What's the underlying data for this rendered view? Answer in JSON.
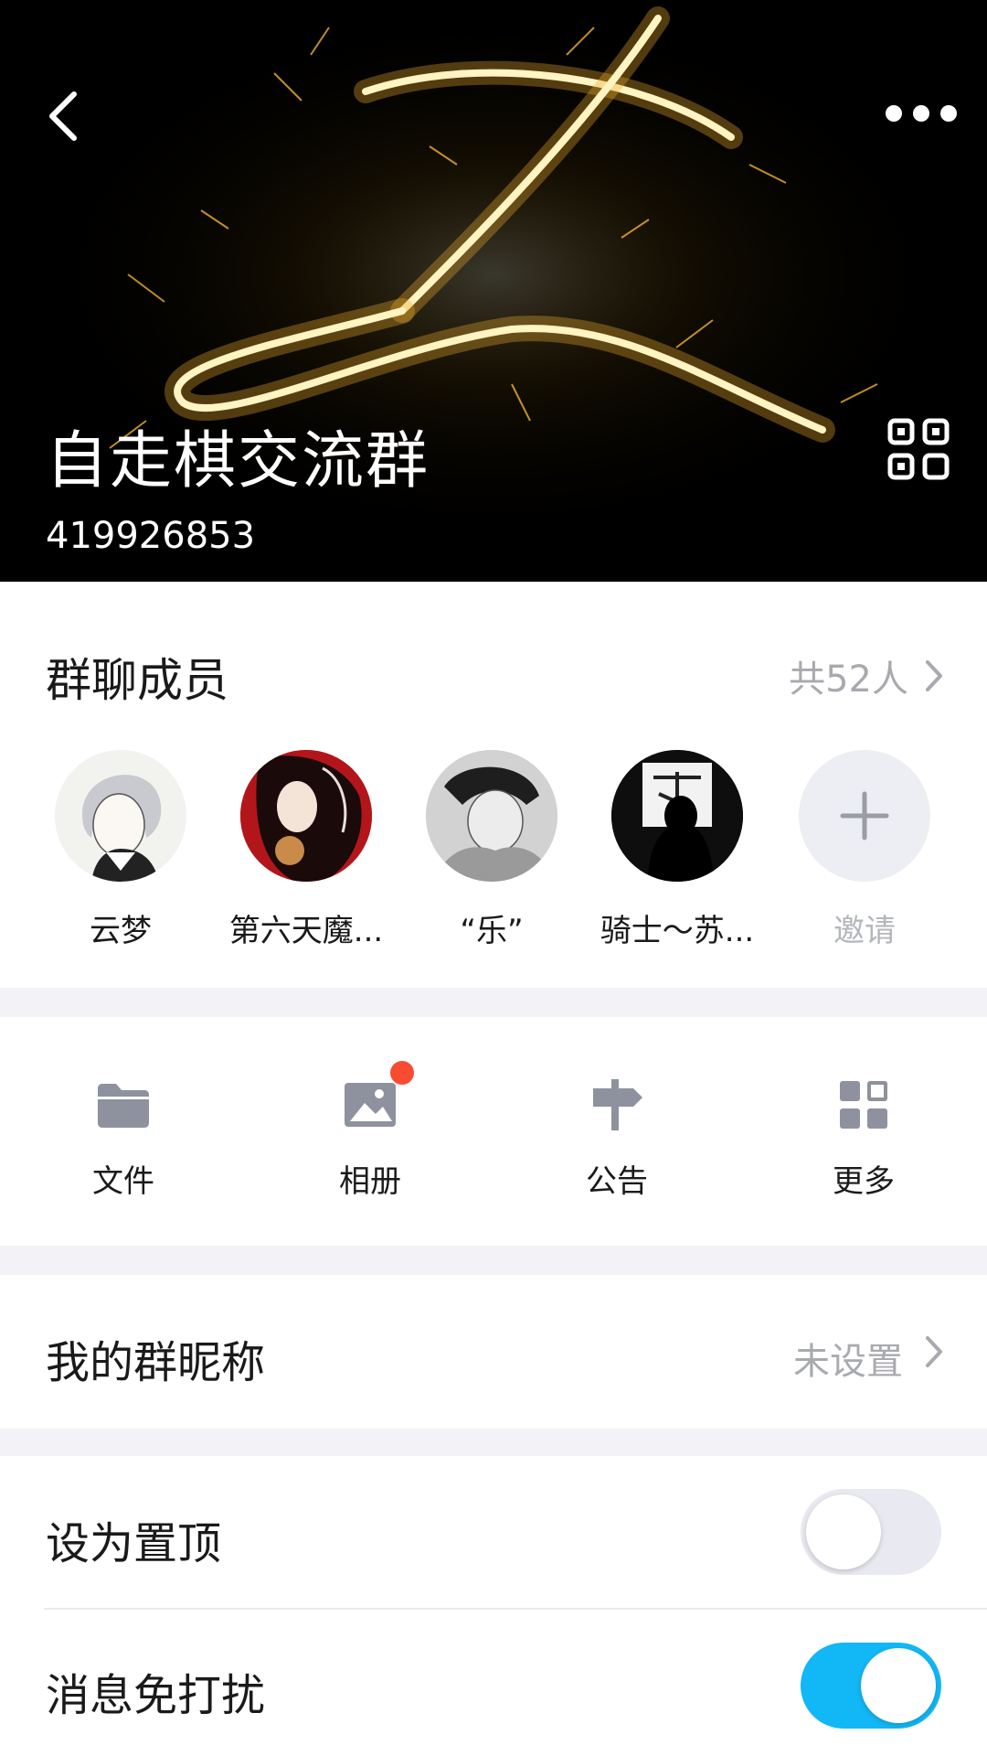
{
  "header": {
    "group_name": "自走棋交流群",
    "group_id": "419926853",
    "back_icon": "chevron-left-icon",
    "more_icon": "ellipsis-icon",
    "qr_icon": "qr-code-icon"
  },
  "members": {
    "title": "群聊成员",
    "count_label": "共52人",
    "list": [
      {
        "name": "云梦"
      },
      {
        "name": "第六天魔..."
      },
      {
        "name": "“乐”"
      },
      {
        "name": "骑士～苏..."
      }
    ],
    "invite_label": "邀请"
  },
  "tools": [
    {
      "label": "文件",
      "icon": "folder-icon"
    },
    {
      "label": "相册",
      "icon": "photo-album-icon",
      "badge": true
    },
    {
      "label": "公告",
      "icon": "signpost-icon"
    },
    {
      "label": "更多",
      "icon": "grid-icon"
    }
  ],
  "settings": {
    "nickname_label": "我的群昵称",
    "nickname_value": "未设置",
    "pin_label": "设为置顶",
    "pin_on": false,
    "mute_label": "消息免打扰",
    "mute_on": true
  },
  "colors": {
    "accent": "#12b7f5",
    "badge": "#f74c31",
    "icon_gray": "#8e929e",
    "secondary_text": "#a9aab0"
  }
}
